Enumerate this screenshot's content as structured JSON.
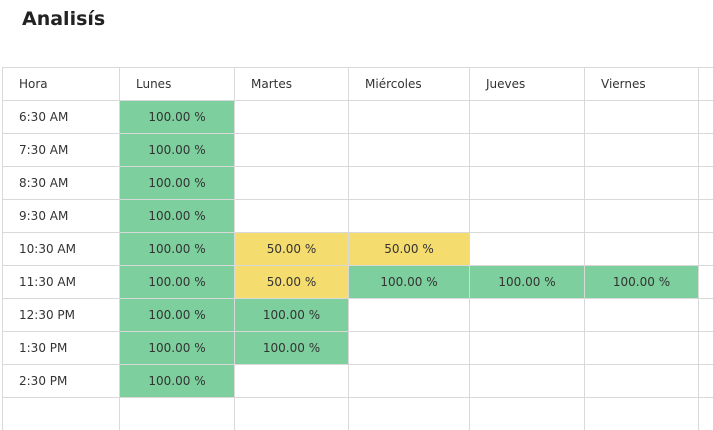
{
  "page": {
    "title": "Analisís"
  },
  "colors": {
    "full": "#7dcf9d",
    "half": "#f5dc6e",
    "empty": "#ffffff",
    "grid": "#d9d9d9"
  },
  "table": {
    "headers": [
      "Hora",
      "Lunes",
      "Martes",
      "Miércoles",
      "Jueves",
      "Viernes",
      ""
    ],
    "rows": [
      {
        "hour": "6:30 AM",
        "cells": [
          {
            "text": "100.00 %",
            "level": "full"
          },
          {
            "text": "",
            "level": "empty"
          },
          {
            "text": "",
            "level": "empty"
          },
          {
            "text": "",
            "level": "empty"
          },
          {
            "text": "",
            "level": "empty"
          },
          {
            "text": "",
            "level": "empty"
          }
        ]
      },
      {
        "hour": "7:30 AM",
        "cells": [
          {
            "text": "100.00 %",
            "level": "full"
          },
          {
            "text": "",
            "level": "empty"
          },
          {
            "text": "",
            "level": "empty"
          },
          {
            "text": "",
            "level": "empty"
          },
          {
            "text": "",
            "level": "empty"
          },
          {
            "text": "",
            "level": "empty"
          }
        ]
      },
      {
        "hour": "8:30 AM",
        "cells": [
          {
            "text": "100.00 %",
            "level": "full"
          },
          {
            "text": "",
            "level": "empty"
          },
          {
            "text": "",
            "level": "empty"
          },
          {
            "text": "",
            "level": "empty"
          },
          {
            "text": "",
            "level": "empty"
          },
          {
            "text": "",
            "level": "empty"
          }
        ]
      },
      {
        "hour": "9:30 AM",
        "cells": [
          {
            "text": "100.00 %",
            "level": "full"
          },
          {
            "text": "",
            "level": "empty"
          },
          {
            "text": "",
            "level": "empty"
          },
          {
            "text": "",
            "level": "empty"
          },
          {
            "text": "",
            "level": "empty"
          },
          {
            "text": "",
            "level": "empty"
          }
        ]
      },
      {
        "hour": "10:30 AM",
        "cells": [
          {
            "text": "100.00 %",
            "level": "full"
          },
          {
            "text": "50.00 %",
            "level": "half"
          },
          {
            "text": "50.00 %",
            "level": "half"
          },
          {
            "text": "",
            "level": "empty"
          },
          {
            "text": "",
            "level": "empty"
          },
          {
            "text": "",
            "level": "empty"
          }
        ]
      },
      {
        "hour": "11:30 AM",
        "cells": [
          {
            "text": "100.00 %",
            "level": "full"
          },
          {
            "text": "50.00 %",
            "level": "half"
          },
          {
            "text": "100.00 %",
            "level": "full"
          },
          {
            "text": "100.00 %",
            "level": "full"
          },
          {
            "text": "100.00 %",
            "level": "full"
          },
          {
            "text": "",
            "level": "empty"
          }
        ]
      },
      {
        "hour": "12:30 PM",
        "cells": [
          {
            "text": "100.00 %",
            "level": "full"
          },
          {
            "text": "100.00 %",
            "level": "full"
          },
          {
            "text": "",
            "level": "empty"
          },
          {
            "text": "",
            "level": "empty"
          },
          {
            "text": "",
            "level": "empty"
          },
          {
            "text": "",
            "level": "empty"
          }
        ]
      },
      {
        "hour": "1:30 PM",
        "cells": [
          {
            "text": "100.00 %",
            "level": "full"
          },
          {
            "text": "100.00 %",
            "level": "full"
          },
          {
            "text": "",
            "level": "empty"
          },
          {
            "text": "",
            "level": "empty"
          },
          {
            "text": "",
            "level": "empty"
          },
          {
            "text": "",
            "level": "empty"
          }
        ]
      },
      {
        "hour": "2:30 PM",
        "cells": [
          {
            "text": "100.00 %",
            "level": "full"
          },
          {
            "text": "",
            "level": "empty"
          },
          {
            "text": "",
            "level": "empty"
          },
          {
            "text": "",
            "level": "empty"
          },
          {
            "text": "",
            "level": "empty"
          },
          {
            "text": "",
            "level": "empty"
          }
        ]
      },
      {
        "hour": "",
        "cells": [
          {
            "text": "",
            "level": "empty"
          },
          {
            "text": "",
            "level": "empty"
          },
          {
            "text": "",
            "level": "empty"
          },
          {
            "text": "",
            "level": "empty"
          },
          {
            "text": "",
            "level": "empty"
          },
          {
            "text": "",
            "level": "empty"
          }
        ]
      }
    ]
  }
}
